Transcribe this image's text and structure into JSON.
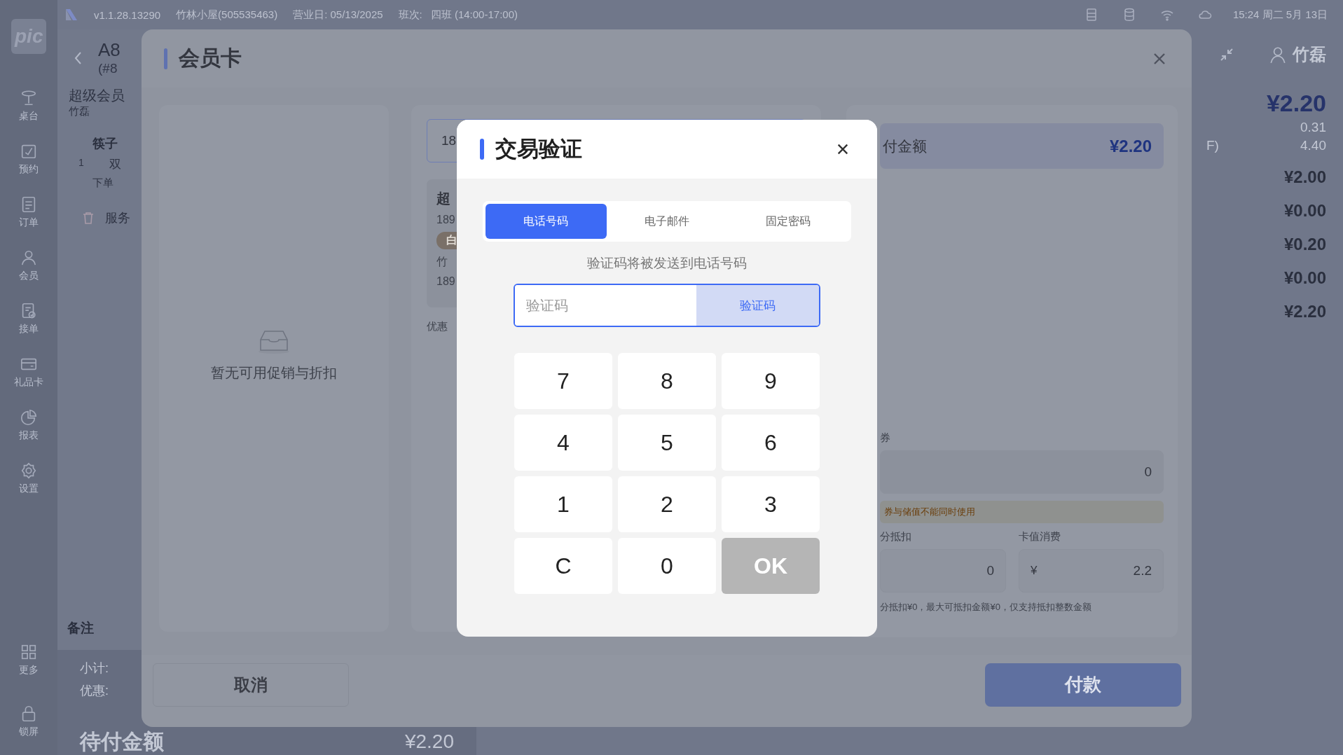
{
  "status_bar": {
    "version": "v1.1.28.13290",
    "store": "竹林小屋(505535463)",
    "business_day": "营业日: 05/13/2025",
    "shift_label": "班次:",
    "shift": "四班 (14:00-17:00)",
    "clock": "15:24 周二 5月 13日"
  },
  "sidebar": {
    "logo": "pic",
    "items": [
      {
        "label": "桌台"
      },
      {
        "label": "预约"
      },
      {
        "label": "订单"
      },
      {
        "label": "会员"
      },
      {
        "label": "接单"
      },
      {
        "label": "礼品卡"
      },
      {
        "label": "报表"
      },
      {
        "label": "设置"
      }
    ],
    "bottom_items": [
      {
        "label": "更多"
      },
      {
        "label": "锁屏"
      }
    ]
  },
  "order": {
    "table": "A8",
    "number": "(#8",
    "member": "超级会员",
    "member_name": "竹磊",
    "items": [
      {
        "qty": "1",
        "name": "筷子",
        "unit": "双",
        "time_label": "下单"
      }
    ],
    "service": "服务",
    "note_label": "备注",
    "subtotal_label": "小计:",
    "discount_label": "优惠:",
    "due_label": "待付金额",
    "due_value": "¥2.20"
  },
  "summary": {
    "user": "竹磊",
    "total": "¥2.20",
    "rows": [
      {
        "value": "0.31",
        "kind": "small"
      },
      {
        "label": "F)",
        "value": "4.40",
        "kind": "small"
      },
      {
        "value": "¥2.00",
        "kind": "amount"
      },
      {
        "value": "¥0.00",
        "kind": "amount"
      },
      {
        "value": "¥0.20",
        "kind": "amount"
      },
      {
        "value": "¥0.00",
        "kind": "amount"
      },
      {
        "value": "¥2.20",
        "kind": "amount"
      }
    ]
  },
  "member_dialog": {
    "title": "会员卡",
    "empty_text": "暂无可用促销与折扣",
    "search_value": "18",
    "card": {
      "title": "超",
      "phone": "189",
      "tag": "白",
      "name": "竹",
      "phone_2": "189"
    },
    "coupon_label": "优惠",
    "payment": {
      "due_label": "付金额",
      "due_value": "¥2.20",
      "coupon_label": "券",
      "coupon_value": "0",
      "warning": "券与储值不能同时使用",
      "points_label": "分抵扣",
      "points_value": "0",
      "stored_label": "卡值消费",
      "stored_currency": "¥",
      "stored_value": "2.2",
      "note": "分抵扣¥0，最大可抵扣金额¥0，仅支持抵扣整数金额"
    },
    "cancel": "取消",
    "pay": "付款"
  },
  "verify_dialog": {
    "title": "交易验证",
    "tabs": [
      {
        "label": "电话号码",
        "selected": true
      },
      {
        "label": "电子邮件",
        "selected": false
      },
      {
        "label": "固定密码",
        "selected": false
      }
    ],
    "hint": "验证码将被发送到电话号码",
    "code_placeholder": "验证码",
    "send_button": "验证码",
    "keys": [
      {
        "label": "7",
        "kind": "digit"
      },
      {
        "label": "8",
        "kind": "digit"
      },
      {
        "label": "9",
        "kind": "digit"
      },
      {
        "label": "4",
        "kind": "digit"
      },
      {
        "label": "5",
        "kind": "digit"
      },
      {
        "label": "6",
        "kind": "digit"
      },
      {
        "label": "1",
        "kind": "digit"
      },
      {
        "label": "2",
        "kind": "digit"
      },
      {
        "label": "3",
        "kind": "digit"
      },
      {
        "label": "C",
        "kind": "clear"
      },
      {
        "label": "0",
        "kind": "digit"
      },
      {
        "label": "OK",
        "kind": "confirm"
      }
    ]
  }
}
